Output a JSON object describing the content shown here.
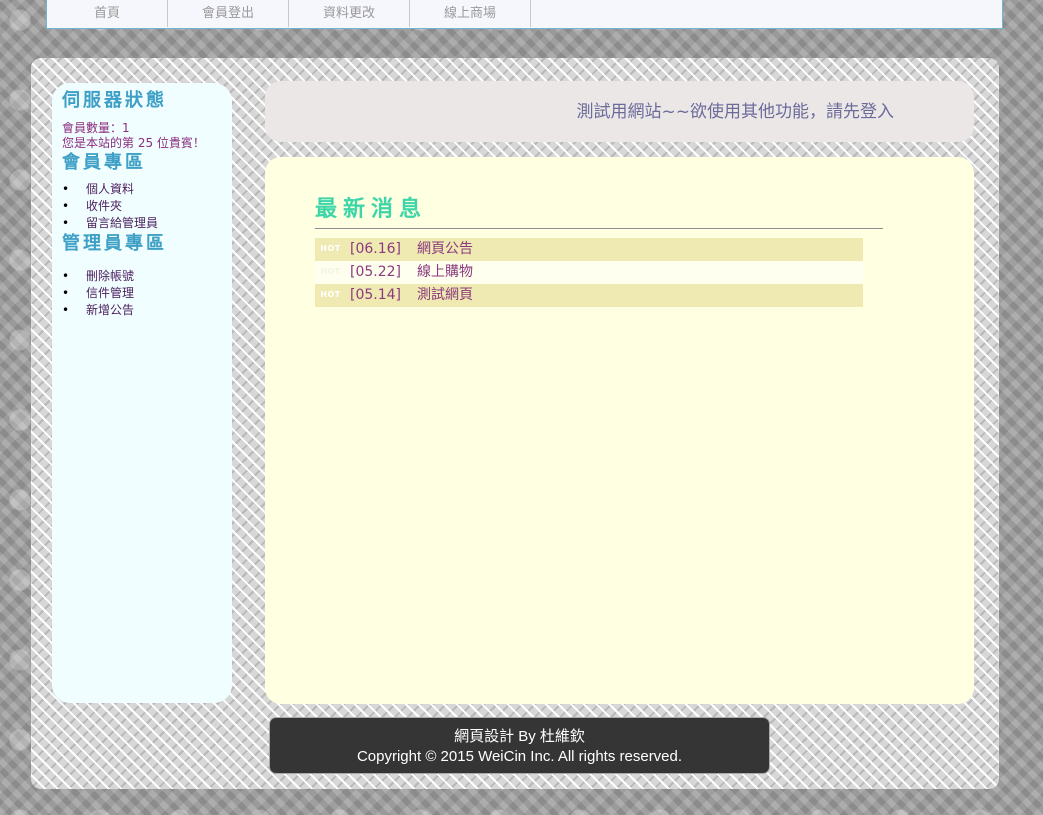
{
  "nav": {
    "items": [
      {
        "label": "首頁"
      },
      {
        "label": "會員登出"
      },
      {
        "label": "資料更改"
      },
      {
        "label": "線上商場"
      }
    ]
  },
  "sidebar": {
    "server_heading": "伺服器狀態",
    "member_count": "會員數量：1",
    "visitor_text": "您是本站的第 25 位貴賓！",
    "member_heading": "會員專區",
    "member_items": [
      {
        "label": "個人資料"
      },
      {
        "label": "收件夾"
      },
      {
        "label": "留言給管理員"
      }
    ],
    "admin_heading": "管理員專區",
    "admin_items": [
      {
        "label": "刪除帳號"
      },
      {
        "label": "信件管理"
      },
      {
        "label": "新增公告"
      }
    ]
  },
  "banner": {
    "text": "測試用網站~~欲使用其他功能，請先登入"
  },
  "news": {
    "title": "最新消息",
    "items": [
      {
        "hot": "HOT",
        "date": "[06.16]",
        "title": "網頁公告"
      },
      {
        "hot": "HOT",
        "date": "[05.22]",
        "title": "線上購物"
      },
      {
        "hot": "HOT",
        "date": "[05.14]",
        "title": "測試網頁"
      }
    ]
  },
  "footer": {
    "line1": "網頁設計 By 杜維欽",
    "line2": "Copyright © 2015 WeiCin Inc. All rights reserved."
  }
}
